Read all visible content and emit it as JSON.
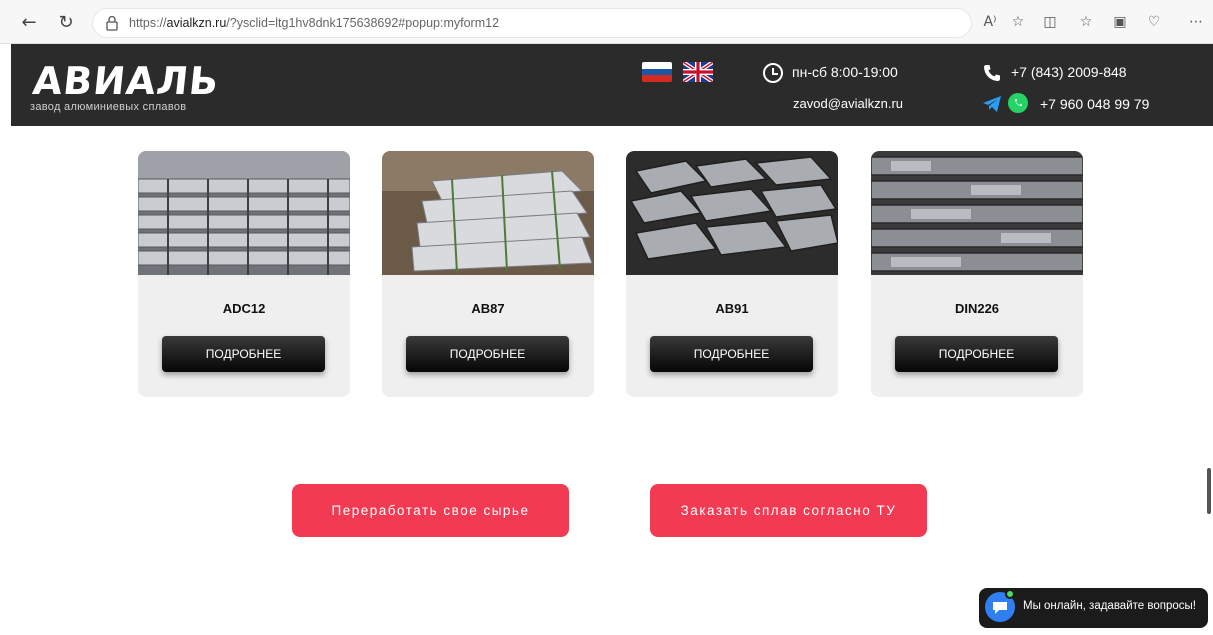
{
  "browser": {
    "url_prefix": "https://",
    "url_domain": "avialkzn.ru",
    "url_rest": "/?ysclid=ltg1hv8dnk175638692#popup:myform12",
    "read_aloud_label": "A⁾"
  },
  "header": {
    "logo": "АВИАЛЬ",
    "logo_subtitle": "завод алюминиевых сплавов",
    "hours": "пн-сб 8:00-19:00",
    "email": "zavod@avialkzn.ru",
    "phone": "+7 (843) 2009-848",
    "mobile": "+7 960 048 99 79"
  },
  "products": [
    {
      "name": "ADC12",
      "button": "ПОДРОБНЕЕ"
    },
    {
      "name": "АВ87",
      "button": "ПОДРОБНЕЕ"
    },
    {
      "name": "АВ91",
      "button": "ПОДРОБНЕЕ"
    },
    {
      "name": "DIN226",
      "button": "ПОДРОБНЕЕ"
    }
  ],
  "actions": {
    "recycle": "Переработать свое сырье",
    "order": "Заказать сплав согласно ТУ"
  },
  "chat": {
    "label": "Мы онлайн, задавайте вопросы!"
  },
  "colors": {
    "header_bg": "#2b2b2b",
    "accent": "#f23b53",
    "card_bg": "#efefef"
  }
}
